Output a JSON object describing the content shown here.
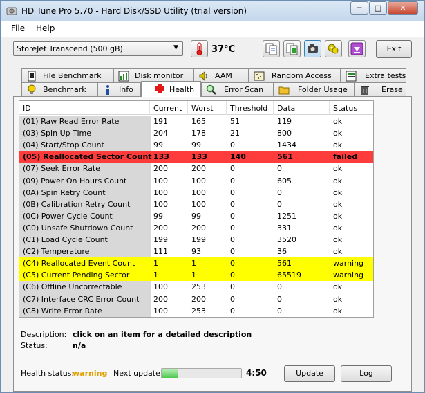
{
  "window": {
    "title": "HD Tune Pro 5.70 - Hard Disk/SSD Utility (trial version)",
    "controls": [
      "minimize-icon",
      "maximize-icon",
      "close-icon"
    ]
  },
  "menu": [
    {
      "label": "File"
    },
    {
      "label": "Help"
    }
  ],
  "toolbar": {
    "drive": "StoreJet Transcend    (500 gB)",
    "temperature": "37°C",
    "buttons": [
      "copy-text-icon",
      "copy-screen-icon",
      "screenshot-camera-icon",
      "settings-icon",
      "save-download-icon"
    ],
    "exit_label": "Exit"
  },
  "tabs_row1": [
    {
      "label": "File Benchmark",
      "icon": "file-benchmark-icon"
    },
    {
      "label": "Disk monitor",
      "icon": "disk-monitor-icon"
    },
    {
      "label": "AAM",
      "icon": "speaker-icon"
    },
    {
      "label": "Random Access",
      "icon": "random-access-icon"
    },
    {
      "label": "Extra tests",
      "icon": "extra-tests-icon"
    }
  ],
  "tabs_row2": [
    {
      "label": "Benchmark",
      "icon": "lightbulb-icon"
    },
    {
      "label": "Info",
      "icon": "info-icon"
    },
    {
      "label": "Health",
      "icon": "red-cross-icon",
      "active": true
    },
    {
      "label": "Error Scan",
      "icon": "magnifier-icon"
    },
    {
      "label": "Folder Usage",
      "icon": "folder-icon"
    },
    {
      "label": "Erase",
      "icon": "trash-icon"
    }
  ],
  "smart_table": {
    "columns": [
      "ID",
      "Current",
      "Worst",
      "Threshold",
      "Data",
      "Status"
    ],
    "rows": [
      {
        "id": "(01) Raw Read Error Rate",
        "current": "191",
        "worst": "165",
        "threshold": "51",
        "data": "119",
        "status": "ok"
      },
      {
        "id": "(03) Spin Up Time",
        "current": "204",
        "worst": "178",
        "threshold": "21",
        "data": "800",
        "status": "ok"
      },
      {
        "id": "(04) Start/Stop Count",
        "current": "99",
        "worst": "99",
        "threshold": "0",
        "data": "1434",
        "status": "ok"
      },
      {
        "id": "(05) Reallocated Sector Count",
        "current": "133",
        "worst": "133",
        "threshold": "140",
        "data": "561",
        "status": "failed",
        "highlight": "red"
      },
      {
        "id": "(07) Seek Error Rate",
        "current": "200",
        "worst": "200",
        "threshold": "0",
        "data": "0",
        "status": "ok"
      },
      {
        "id": "(09) Power On Hours Count",
        "current": "100",
        "worst": "100",
        "threshold": "0",
        "data": "605",
        "status": "ok"
      },
      {
        "id": "(0A) Spin Retry Count",
        "current": "100",
        "worst": "100",
        "threshold": "0",
        "data": "0",
        "status": "ok"
      },
      {
        "id": "(0B) Calibration Retry Count",
        "current": "100",
        "worst": "100",
        "threshold": "0",
        "data": "0",
        "status": "ok"
      },
      {
        "id": "(0C) Power Cycle Count",
        "current": "99",
        "worst": "99",
        "threshold": "0",
        "data": "1251",
        "status": "ok"
      },
      {
        "id": "(C0) Unsafe Shutdown Count",
        "current": "200",
        "worst": "200",
        "threshold": "0",
        "data": "331",
        "status": "ok"
      },
      {
        "id": "(C1) Load Cycle Count",
        "current": "199",
        "worst": "199",
        "threshold": "0",
        "data": "3520",
        "status": "ok"
      },
      {
        "id": "(C2) Temperature",
        "current": "111",
        "worst": "93",
        "threshold": "0",
        "data": "36",
        "status": "ok"
      },
      {
        "id": "(C4) Reallocated Event Count",
        "current": "1",
        "worst": "1",
        "threshold": "0",
        "data": "561",
        "status": "warning",
        "highlight": "yellow"
      },
      {
        "id": "(C5) Current Pending Sector",
        "current": "1",
        "worst": "1",
        "threshold": "0",
        "data": "65519",
        "status": "warning",
        "highlight": "yellow"
      },
      {
        "id": "(C6) Offline Uncorrectable",
        "current": "100",
        "worst": "253",
        "threshold": "0",
        "data": "0",
        "status": "ok"
      },
      {
        "id": "(C7) Interface CRC Error Count",
        "current": "200",
        "worst": "200",
        "threshold": "0",
        "data": "0",
        "status": "ok"
      },
      {
        "id": "(C8) Write Error Rate",
        "current": "100",
        "worst": "253",
        "threshold": "0",
        "data": "0",
        "status": "ok"
      }
    ]
  },
  "description": {
    "label": "Description:",
    "value": "click on an item for a detailed description",
    "status_label": "Status:",
    "status_value": "n/a"
  },
  "footer": {
    "health_label": "Health status:",
    "health_value": "warning",
    "next_update_label": "Next update:",
    "progress_fraction": 0.2,
    "countdown": "4:50",
    "update_label": "Update",
    "log_label": "Log"
  },
  "colors": {
    "failed_row": "#ff3c3c",
    "warning_row": "#ffff00",
    "warning_text": "#e0a000"
  }
}
